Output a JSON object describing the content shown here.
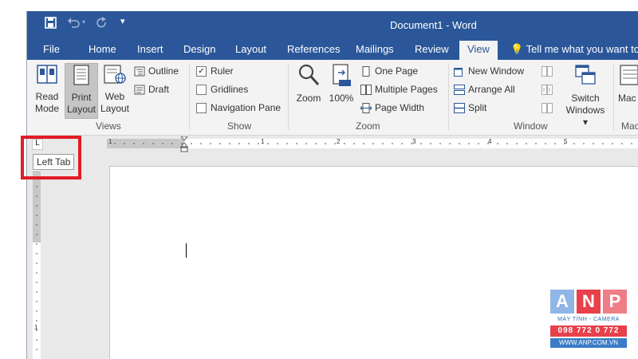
{
  "app": {
    "title": "Document1 - Word",
    "qat": {
      "save_icon": "save-icon",
      "undo_icon": "undo-icon",
      "redo_icon": "redo-icon",
      "customize_icon": "customize-qat-icon"
    }
  },
  "tabs": [
    "File",
    "Home",
    "Insert",
    "Design",
    "Layout",
    "References",
    "Mailings",
    "Review",
    "View"
  ],
  "active_tab": "View",
  "tell_me": "Tell me what you want to d",
  "ribbon": {
    "views": {
      "label": "Views",
      "read_mode": [
        "Read",
        "Mode"
      ],
      "print_layout": [
        "Print",
        "Layout"
      ],
      "web_layout": [
        "Web",
        "Layout"
      ],
      "outline": "Outline",
      "draft": "Draft"
    },
    "show": {
      "label": "Show",
      "ruler": "Ruler",
      "ruler_checked": "✓",
      "gridlines": "Gridlines",
      "navigation_pane": "Navigation Pane"
    },
    "zoom": {
      "label": "Zoom",
      "zoom": "Zoom",
      "percent": "100%",
      "one_page": "One Page",
      "multiple_pages": "Multiple Pages",
      "page_width": "Page Width",
      "badge": "100"
    },
    "window": {
      "label": "Window",
      "new_window": "New Window",
      "arrange_all": "Arrange All",
      "split": "Split",
      "switch_windows": [
        "Switch",
        "Windows ▾"
      ]
    },
    "macros": {
      "label": "Mac",
      "button": "Mac"
    }
  },
  "ruler": {
    "tab_selector_glyph": "L",
    "numbers": [
      "1",
      "1",
      "2",
      "3",
      "4",
      "5"
    ],
    "vertical_number": "1"
  },
  "tooltip": "Left Tab",
  "watermark": {
    "letters": [
      "A",
      "N",
      "P"
    ],
    "tagline": "MÁY TÍNH - CAMERA",
    "phone": "098 772 0 772",
    "website": "WWW.ANP.COM.VN"
  },
  "colors": {
    "accent": "#2b579a",
    "highlight": "#e21b23"
  }
}
